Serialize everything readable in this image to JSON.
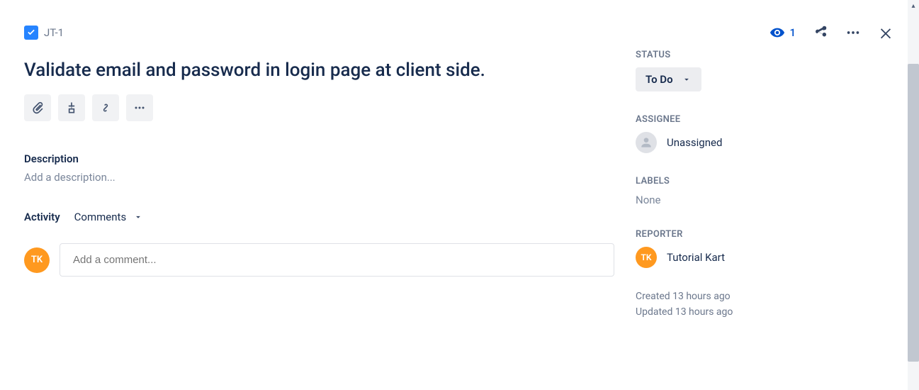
{
  "breadcrumb": {
    "issue_key": "JT-1"
  },
  "header_actions": {
    "watch_count": "1"
  },
  "issue": {
    "title": "Validate email and password in login page at client side."
  },
  "description": {
    "label": "Description",
    "placeholder": "Add a description..."
  },
  "activity": {
    "label": "Activity",
    "filter_label": "Comments"
  },
  "comment": {
    "avatar_initials": "TK",
    "placeholder": "Add a comment..."
  },
  "sidebar": {
    "status": {
      "label": "STATUS",
      "value": "To Do"
    },
    "assignee": {
      "label": "ASSIGNEE",
      "value": "Unassigned"
    },
    "labels": {
      "label": "LABELS",
      "value": "None"
    },
    "reporter": {
      "label": "REPORTER",
      "avatar_initials": "TK",
      "value": "Tutorial Kart"
    },
    "created": "Created 13 hours ago",
    "updated": "Updated 13 hours ago"
  }
}
